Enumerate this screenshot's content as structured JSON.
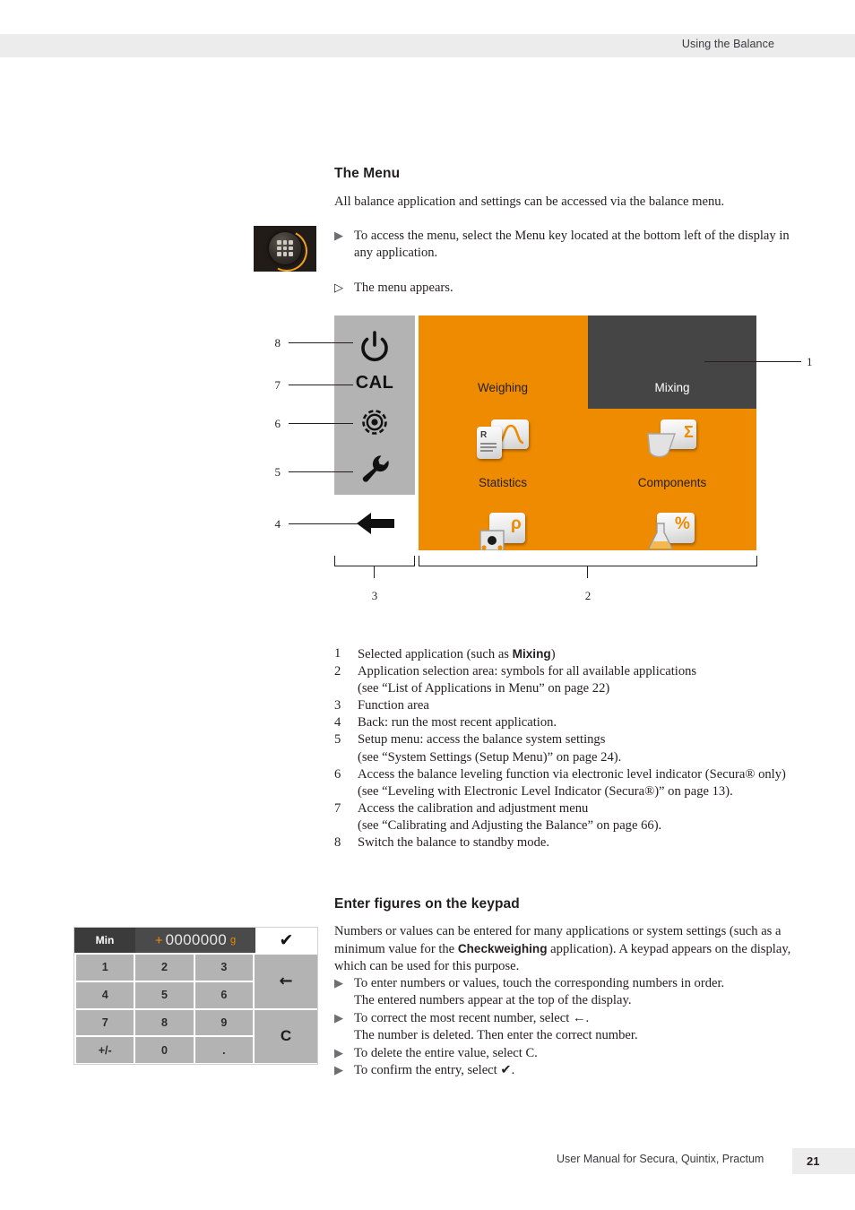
{
  "header": {
    "running_head": "Using the Balance"
  },
  "footer": {
    "manual_title": "User Manual for Secura, Quintix, Practum",
    "page_number": "21"
  },
  "colors": {
    "accent_orange": "#ef8b00",
    "selected_tile": "#454545",
    "function_area_gray": "#b3b3b3",
    "header_band": "#ececed"
  },
  "section_menu": {
    "heading": "The Menu",
    "intro": "All balance application and settings can be accessed via the balance menu.",
    "steps": [
      {
        "glyph": "▶",
        "text": "To access the menu, select the Menu key located at the bottom left of the display in any application."
      },
      {
        "glyph": "▷",
        "text": "The menu appears."
      }
    ],
    "menu_key_icon": "menu-grid-icon"
  },
  "display_figure": {
    "function_area_icons": [
      {
        "name": "standby-power-icon",
        "callout": "8",
        "glyph": "power"
      },
      {
        "name": "calibration-cal-icon",
        "callout": "7",
        "glyph": "CAL"
      },
      {
        "name": "level-indicator-icon",
        "callout": "6",
        "glyph": "level"
      },
      {
        "name": "setup-wrench-icon",
        "callout": "5",
        "glyph": "wrench"
      }
    ],
    "back_icon": {
      "name": "back-arrow-icon",
      "callout": "4",
      "glyph": "←"
    },
    "applications": [
      {
        "label": "Weighing",
        "selected": false,
        "icon": "weighing-icon"
      },
      {
        "label": "Mixing",
        "selected": true,
        "icon": "mixing-icon"
      },
      {
        "label": "Statistics",
        "selected": false,
        "icon": "statistics-icon"
      },
      {
        "label": "Components",
        "selected": false,
        "icon": "components-icon"
      },
      {
        "label": "",
        "selected": false,
        "icon": "density-rho-icon"
      },
      {
        "label": "",
        "selected": false,
        "icon": "percent-icon"
      }
    ],
    "callout_selected_app": "1",
    "callout_app_selection_area": "2",
    "callout_function_area": "3",
    "icon_glyphs": {
      "sigma": "Σ",
      "rho": "ρ",
      "percent": "%",
      "report": "R"
    }
  },
  "legend_items": [
    {
      "num": "1",
      "lines": [
        {
          "text": "Selected application (such as ",
          "bold_after": "Mixing",
          "tail": ")"
        }
      ]
    },
    {
      "num": "2",
      "lines": [
        {
          "text": "Application selection area: symbols for all available applications"
        },
        {
          "text": "(see “List of Applications in Menu” on page 22)"
        }
      ]
    },
    {
      "num": "3",
      "lines": [
        {
          "text": "Function area"
        }
      ]
    },
    {
      "num": "4",
      "lines": [
        {
          "text": "Back: run the most recent application."
        }
      ]
    },
    {
      "num": "5",
      "lines": [
        {
          "text": "Setup menu: access the balance system settings"
        },
        {
          "text": "(see “System Settings (Setup Menu)” on page 24)."
        }
      ]
    },
    {
      "num": "6",
      "lines": [
        {
          "text": "Access the balance leveling function via electronic level indicator (Secura® only)"
        },
        {
          "text": "(see “Leveling with Electronic Level Indicator (Secura®)” on page 13)."
        }
      ]
    },
    {
      "num": "7",
      "lines": [
        {
          "text": "Access the calibration and adjustment menu"
        },
        {
          "text": "(see “Calibrating and Adjusting the Balance” on page 66)."
        }
      ]
    },
    {
      "num": "8",
      "lines": [
        {
          "text": "Switch the balance to standby mode."
        }
      ]
    }
  ],
  "section_keypad": {
    "heading": "Enter figures on the keypad",
    "intro_part1": "Numbers or values can be entered for many applications or system settings (such as a minimum value for the ",
    "intro_bold": "Checkweighing",
    "intro_part2": " application). A keypad appears on the display, which can be used for this purpose.",
    "steps": [
      {
        "glyph": "▶",
        "line1": "To enter numbers or values, touch the corresponding numbers in order.",
        "line2": "The entered numbers appear at the top of the display."
      },
      {
        "glyph": "▶",
        "line1": "To correct the most recent number, select ←.",
        "line2": "The number is deleted. Then enter the correct number."
      },
      {
        "glyph": "▶",
        "line1": "To delete the entire value, select C.",
        "line2": ""
      },
      {
        "glyph": "▶",
        "line1": "To confirm the entry, select ✔.",
        "line2": ""
      }
    ]
  },
  "keypad_graphic": {
    "min_label": "Min",
    "value_sign": "+",
    "value_digits": "0000000",
    "value_unit": "g",
    "confirm_glyph": "✔",
    "keys": [
      "1",
      "2",
      "3",
      "4",
      "5",
      "6",
      "7",
      "8",
      "9",
      "+/-",
      "0",
      "."
    ],
    "backspace_glyph": "←",
    "clear_label": "C"
  }
}
